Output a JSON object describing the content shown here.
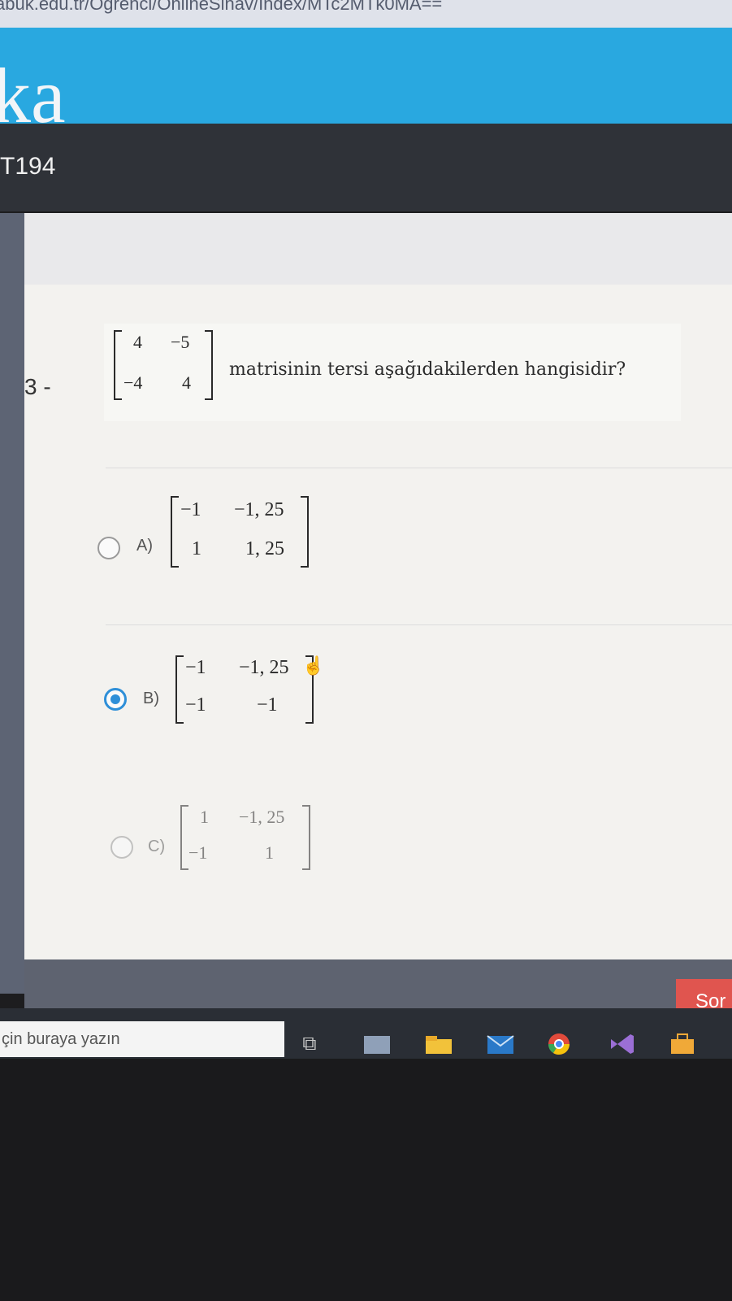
{
  "browser": {
    "url": "abuk.edu.tr/Ogrenci/OnlineSinav/Index/MTc2MTk0MA=="
  },
  "header": {
    "logo_text": "ka",
    "course_code": "T194"
  },
  "question": {
    "number": "3 -",
    "text": "matrisinin tersi aşağıdakilerden hangisidir?",
    "matrix": [
      [
        "4",
        "−5"
      ],
      [
        "−4",
        "4"
      ]
    ]
  },
  "options": [
    {
      "letter": "A)",
      "matrix": [
        [
          "−1",
          "−1, 25"
        ],
        [
          "1",
          "1, 25"
        ]
      ],
      "selected": false
    },
    {
      "letter": "B)",
      "matrix": [
        [
          "−1",
          "−1, 25"
        ],
        [
          "−1",
          "−1"
        ]
      ],
      "selected": true
    },
    {
      "letter": "C)",
      "matrix": [
        [
          "1",
          "−1, 25"
        ],
        [
          "−1",
          "1"
        ]
      ],
      "selected": false
    }
  ],
  "footer": {
    "next_label": "Sor"
  },
  "taskbar": {
    "search_placeholder": "çin buraya yazın"
  },
  "colors": {
    "accent": "#29a8e0",
    "selected_radio": "#2e8fd8",
    "next_button": "#e0554f"
  },
  "icons": [
    "task-view-icon",
    "app-icon",
    "file-explorer-icon",
    "mail-icon",
    "chrome-icon",
    "visual-studio-icon",
    "store-icon"
  ]
}
